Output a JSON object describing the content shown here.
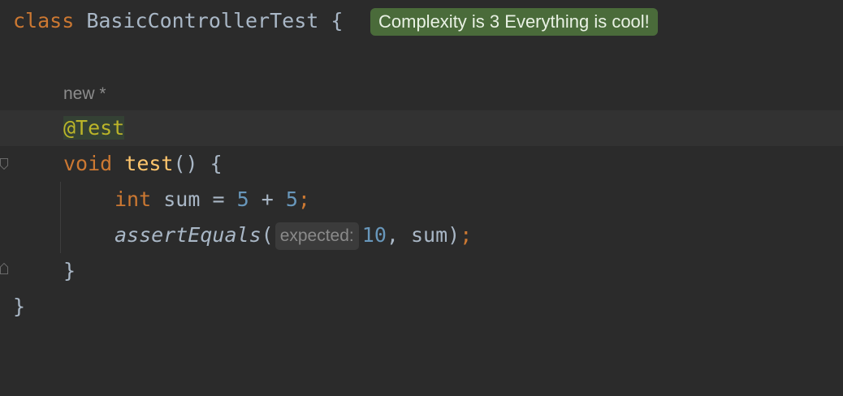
{
  "code": {
    "line1": {
      "keyword": "class",
      "name": "BasicControllerTest",
      "brace": "{"
    },
    "badge": {
      "text": "Complexity is 3 Everything is cool!"
    },
    "lens": {
      "text": "new *"
    },
    "annotation": {
      "text": "@Test"
    },
    "method": {
      "keyword": "void",
      "name": "test",
      "params": "()",
      "brace": "{"
    },
    "stmt1": {
      "type": "int",
      "name": "sum",
      "op1": "=",
      "num1": "5",
      "op2": "+",
      "num2": "5",
      "semi": ";"
    },
    "stmt2": {
      "call": "assertEquals",
      "open": "(",
      "hint": "expected:",
      "value": "10",
      "comma": ",",
      "arg": "sum",
      "close": ")",
      "semi": ";"
    },
    "close_method": "}",
    "close_class": "}"
  },
  "colors": {
    "background": "#2b2b2b",
    "current_line": "#323232",
    "keyword": "#cc7832",
    "function": "#ffc66d",
    "number": "#6897bb",
    "annotation": "#bbb529",
    "badge": "#4a6b3a"
  }
}
